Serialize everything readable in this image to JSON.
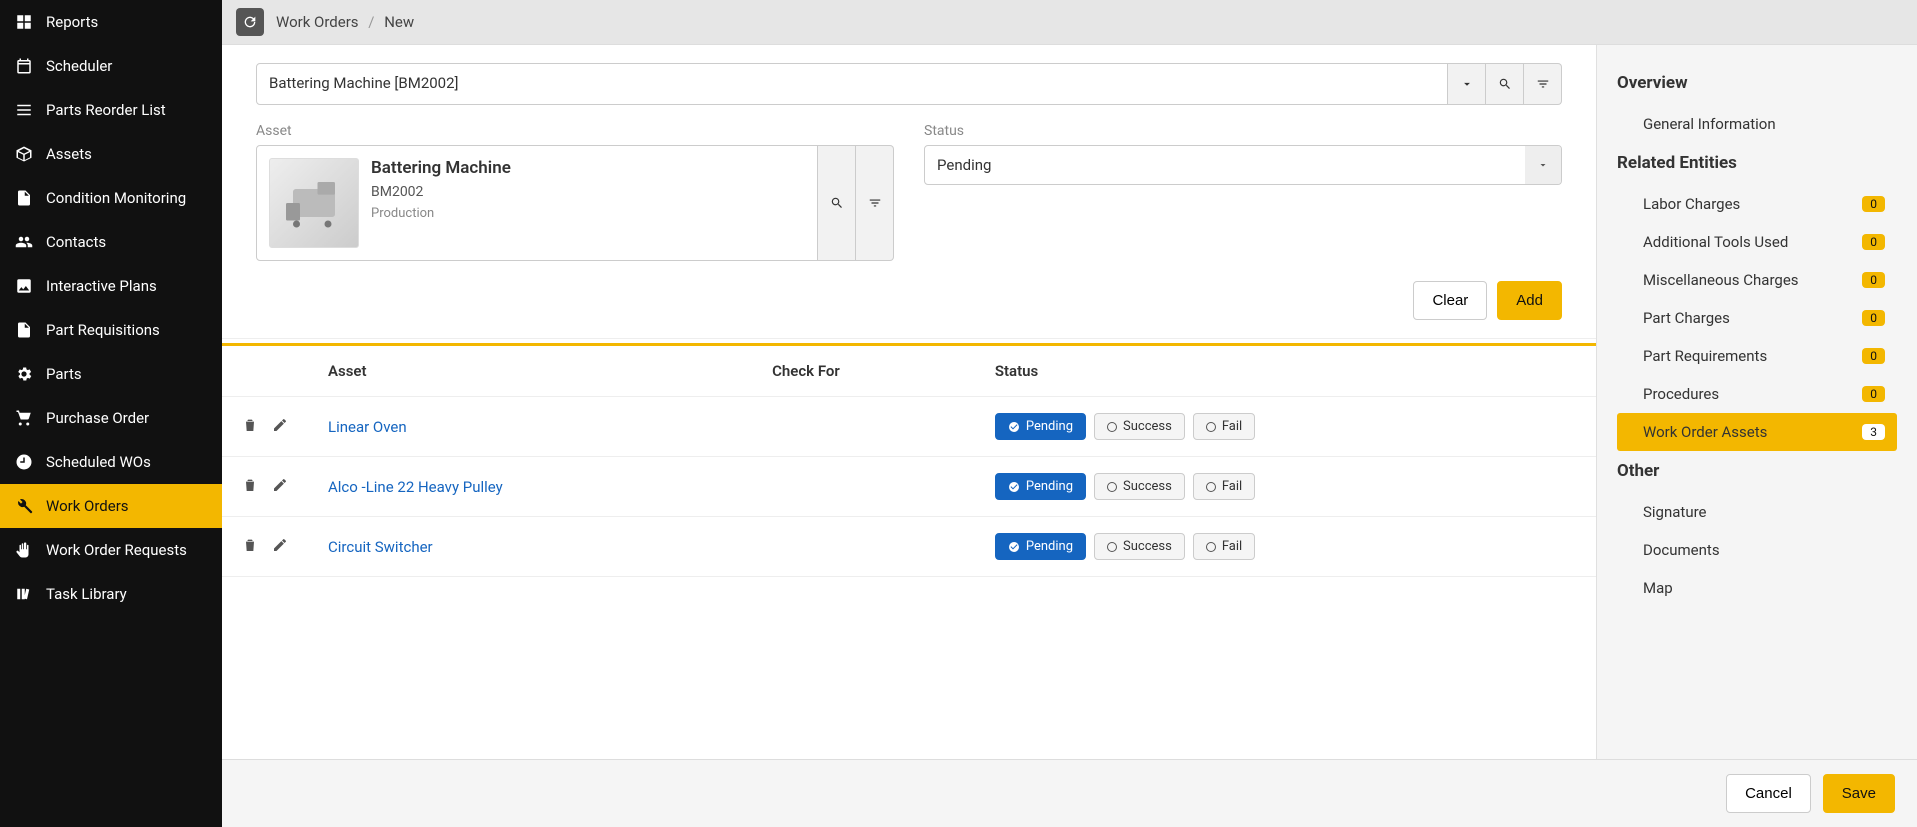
{
  "sidebar": {
    "items": [
      {
        "label": "Reports",
        "icon": "grid-icon"
      },
      {
        "label": "Scheduler",
        "icon": "calendar-icon"
      },
      {
        "label": "Parts Reorder List",
        "icon": "list-icon"
      },
      {
        "label": "Assets",
        "icon": "box-icon"
      },
      {
        "label": "Condition Monitoring",
        "icon": "document-icon"
      },
      {
        "label": "Contacts",
        "icon": "users-icon"
      },
      {
        "label": "Interactive Plans",
        "icon": "image-icon"
      },
      {
        "label": "Part Requisitions",
        "icon": "document-icon"
      },
      {
        "label": "Parts",
        "icon": "gear-icon"
      },
      {
        "label": "Purchase Order",
        "icon": "cart-icon"
      },
      {
        "label": "Scheduled WOs",
        "icon": "clock-icon"
      },
      {
        "label": "Work Orders",
        "icon": "wrench-icon",
        "active": true
      },
      {
        "label": "Work Order Requests",
        "icon": "hand-icon"
      },
      {
        "label": "Task Library",
        "icon": "library-icon"
      }
    ]
  },
  "breadcrumb": {
    "root": "Work Orders",
    "leaf": "New"
  },
  "form": {
    "picker_value": "Battering Machine [BM2002]",
    "asset_label": "Asset",
    "status_label": "Status",
    "asset": {
      "name": "Battering Machine",
      "code": "BM2002",
      "category": "Production"
    },
    "status_value": "Pending",
    "clear": "Clear",
    "add": "Add"
  },
  "table": {
    "headers": {
      "asset": "Asset",
      "check": "Check For",
      "status": "Status"
    },
    "chips": {
      "pending": "Pending",
      "success": "Success",
      "fail": "Fail"
    },
    "rows": [
      {
        "name": "Linear Oven"
      },
      {
        "name": "Alco -Line 22 Heavy Pulley"
      },
      {
        "name": "Circuit Switcher"
      }
    ]
  },
  "rightpanel": {
    "overview": "Overview",
    "general_info": "General Information",
    "related": "Related Entities",
    "items": [
      {
        "label": "Labor Charges",
        "count": "0"
      },
      {
        "label": "Additional Tools Used",
        "count": "0"
      },
      {
        "label": "Miscellaneous Charges",
        "count": "0"
      },
      {
        "label": "Part Charges",
        "count": "0"
      },
      {
        "label": "Part Requirements",
        "count": "0"
      },
      {
        "label": "Procedures",
        "count": "0"
      },
      {
        "label": "Work Order Assets",
        "count": "3",
        "active": true
      }
    ],
    "other": "Other",
    "other_items": [
      {
        "label": "Signature"
      },
      {
        "label": "Documents"
      },
      {
        "label": "Map"
      }
    ]
  },
  "footer": {
    "cancel": "Cancel",
    "save": "Save"
  }
}
